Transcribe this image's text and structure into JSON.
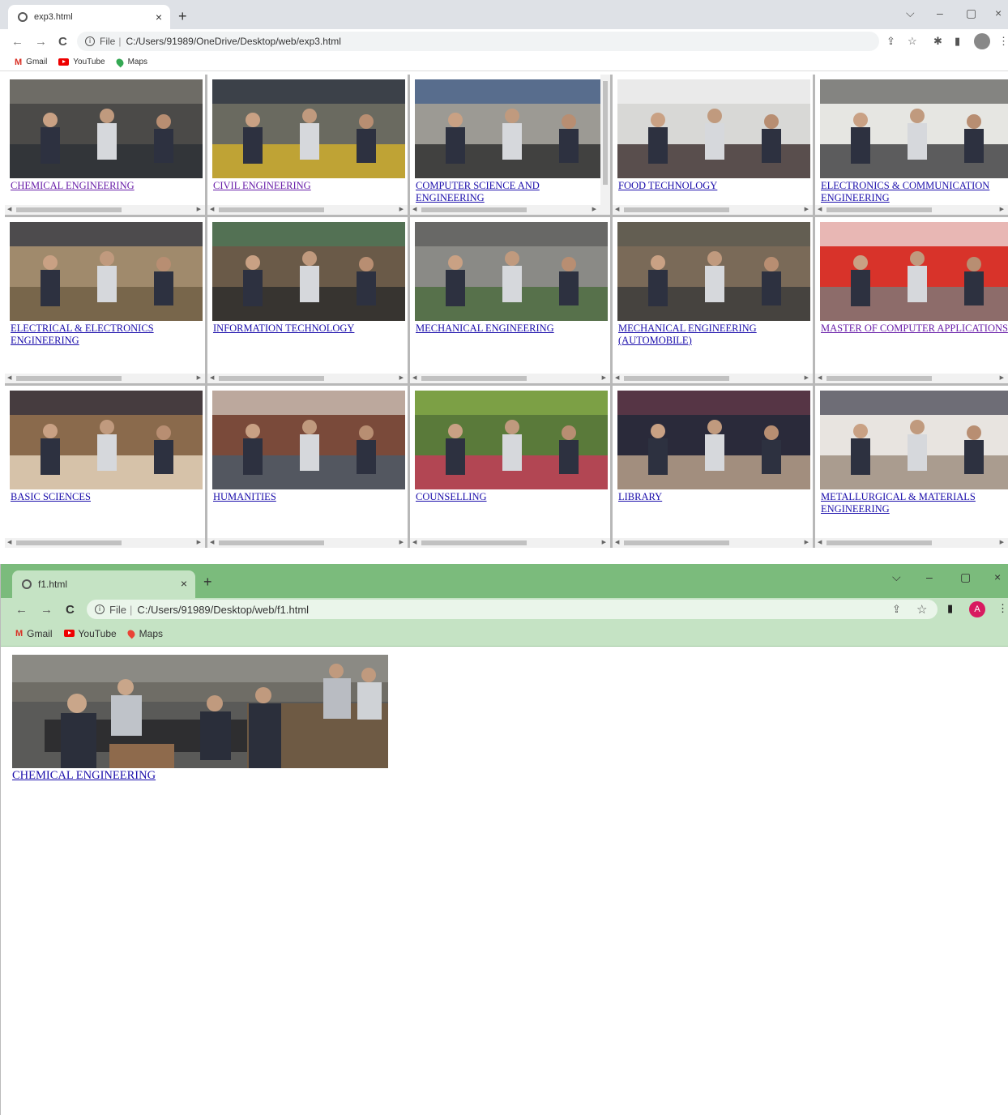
{
  "window1": {
    "tab_title": "exp3.html",
    "new_tab": "+",
    "url_scheme": "File",
    "url": "C:/Users/91989/OneDrive/Desktop/web/exp3.html",
    "bookmarks": [
      "Gmail",
      "YouTube",
      "Maps"
    ],
    "frames": [
      {
        "label": "CHEMICAL ENGINEERING",
        "visited": true
      },
      {
        "label": "CIVIL ENGINEERING",
        "visited": true
      },
      {
        "label": "COMPUTER SCIENCE AND ENGINEERING",
        "visited": false
      },
      {
        "label": "FOOD TECHNOLOGY",
        "visited": false
      },
      {
        "label": "ELECTRONICS & COMMUNICATION ENGINEERING",
        "visited": false
      },
      {
        "label": "ELECTRICAL & ELECTRONICS ENGINEERING",
        "visited": false
      },
      {
        "label": "INFORMATION TECHNOLOGY",
        "visited": false
      },
      {
        "label": "MECHANICAL ENGINEERING",
        "visited": false
      },
      {
        "label": "MECHANICAL ENGINEERING (AUTOMOBILE)",
        "visited": false
      },
      {
        "label": "MASTER OF COMPUTER APPLICATIONS",
        "visited": true
      },
      {
        "label": "BASIC SCIENCES",
        "visited": false
      },
      {
        "label": "HUMANITIES",
        "visited": false
      },
      {
        "label": "COUNSELLING",
        "visited": false
      },
      {
        "label": "LIBRARY",
        "visited": false
      },
      {
        "label": "METALLURGICAL & MATERIALS ENGINEERING",
        "visited": false
      }
    ]
  },
  "window2": {
    "tab_title": "f1.html",
    "new_tab": "+",
    "url_scheme": "File",
    "url": "C:/Users/91989/Desktop/web/f1.html",
    "bookmarks": [
      "Gmail",
      "YouTube",
      "Maps"
    ],
    "profile_initial": "A",
    "link_label": "CHEMICAL ENGINEERING"
  },
  "colors": {
    "link": "#1a0dab",
    "visited_link": "#681da8",
    "theme_green": "#7bbb7c",
    "theme_green_light": "#c5e3c4"
  },
  "icons": {
    "back": "←",
    "forward": "→",
    "reload": "C",
    "close": "×",
    "minimize": "–",
    "maximize": "▢",
    "dropdown": "⌵",
    "share": "⇪",
    "star": "☆",
    "extensions": "✱",
    "sidepanel": "▮",
    "menu": "⋮"
  }
}
